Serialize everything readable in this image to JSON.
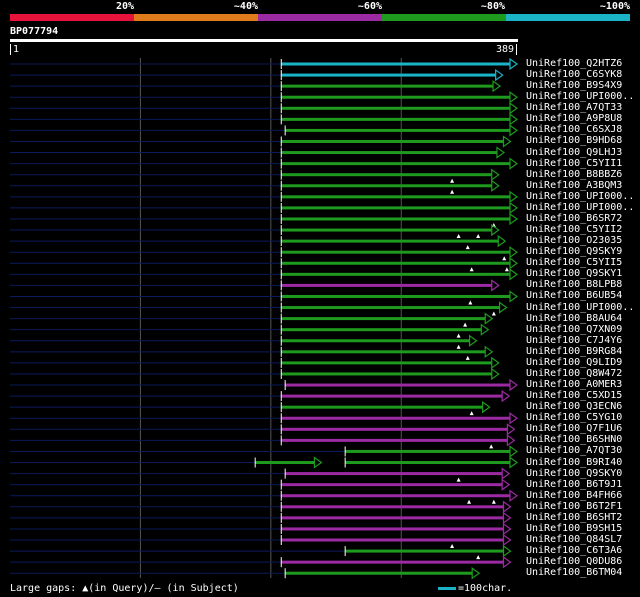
{
  "colors": {
    "red": "#e8133a",
    "orange": "#e07c1c",
    "purple": "#9b2aa3",
    "green": "#1e9a1e",
    "cyan": "#1ab3c8",
    "bg": "#000000"
  },
  "legend": {
    "labels": [
      "20%",
      "~40%",
      "~60%",
      "~80%",
      "~100%"
    ]
  },
  "query": {
    "id": "BP077794",
    "start": "1",
    "end": "389"
  },
  "footer": {
    "gaps_text": "Large gaps: ▲(in Query)/– (in Subject)",
    "scale_text": "=100char."
  },
  "hits": [
    {
      "label": "UniRef100_Q2HTZ6",
      "color": "cyan",
      "s": 209,
      "e": 389,
      "ext": 1,
      "marks": []
    },
    {
      "label": "UniRef100_C6SYK8",
      "color": "cyan",
      "s": 209,
      "e": 378,
      "ext": 1,
      "marks": []
    },
    {
      "label": "UniRef100_B9S4X9",
      "color": "green",
      "s": 209,
      "e": 376,
      "ext": 1,
      "marks": []
    },
    {
      "label": "UniRef100_UPI000..",
      "color": "green",
      "s": 209,
      "e": 389,
      "ext": 1,
      "marks": []
    },
    {
      "label": "UniRef100_A7QT33",
      "color": "green",
      "s": 209,
      "e": 389,
      "ext": 1,
      "marks": []
    },
    {
      "label": "UniRef100_A9P8U8",
      "color": "green",
      "s": 209,
      "e": 389,
      "ext": 1,
      "marks": []
    },
    {
      "label": "UniRef100_C6SXJ8",
      "color": "green",
      "s": 212,
      "e": 389,
      "ext": 1,
      "marks": []
    },
    {
      "label": "UniRef100_B9HD68",
      "color": "green",
      "s": 209,
      "e": 384,
      "ext": 1,
      "marks": []
    },
    {
      "label": "UniRef100_Q9LHJ3",
      "color": "green",
      "s": 209,
      "e": 379,
      "ext": 1,
      "marks": []
    },
    {
      "label": "UniRef100_C5YII1",
      "color": "green",
      "s": 209,
      "e": 389,
      "ext": 1,
      "marks": []
    },
    {
      "label": "UniRef100_B8BBZ6",
      "color": "green",
      "s": 209,
      "e": 375,
      "ext": 1,
      "marks": [
        340
      ]
    },
    {
      "label": "UniRef100_A3BQM3",
      "color": "green",
      "s": 209,
      "e": 375,
      "ext": 1,
      "marks": [
        340
      ]
    },
    {
      "label": "UniRef100_UPI000..",
      "color": "green",
      "s": 209,
      "e": 389,
      "ext": 1,
      "marks": []
    },
    {
      "label": "UniRef100_UPI000..",
      "color": "green",
      "s": 209,
      "e": 389,
      "ext": 1,
      "marks": []
    },
    {
      "label": "UniRef100_B6SR72",
      "color": "green",
      "s": 209,
      "e": 389,
      "ext": 1,
      "marks": [
        372
      ]
    },
    {
      "label": "UniRef100_C5YII2",
      "color": "green",
      "s": 209,
      "e": 375,
      "ext": 1,
      "marks": [
        345,
        360
      ]
    },
    {
      "label": "UniRef100_O23035",
      "color": "green",
      "s": 209,
      "e": 380,
      "ext": 1,
      "marks": [
        352
      ]
    },
    {
      "label": "UniRef100_Q9SKY9",
      "color": "green",
      "s": 209,
      "e": 389,
      "ext": 1,
      "marks": [
        380
      ]
    },
    {
      "label": "UniRef100_C5YII5",
      "color": "green",
      "s": 209,
      "e": 389,
      "ext": 1,
      "marks": [
        355,
        382
      ]
    },
    {
      "label": "UniRef100_Q9SKY1",
      "color": "green",
      "s": 209,
      "e": 389,
      "ext": 1,
      "marks": []
    },
    {
      "label": "UniRef100_B8LPB8",
      "color": "purple",
      "s": 209,
      "e": 375,
      "ext": 1,
      "marks": []
    },
    {
      "label": "UniRef100_B6UB54",
      "color": "green",
      "s": 209,
      "e": 389,
      "ext": 1,
      "marks": [
        354
      ]
    },
    {
      "label": "UniRef100_UPI000..",
      "color": "green",
      "s": 209,
      "e": 381,
      "ext": 1,
      "marks": [
        372
      ]
    },
    {
      "label": "UniRef100_B8AU64",
      "color": "green",
      "s": 209,
      "e": 370,
      "ext": 1,
      "marks": [
        350
      ]
    },
    {
      "label": "UniRef100_Q7XN09",
      "color": "green",
      "s": 209,
      "e": 367,
      "ext": 1,
      "marks": [
        345
      ]
    },
    {
      "label": "UniRef100_C7J4Y6",
      "color": "green",
      "s": 209,
      "e": 358,
      "ext": 1,
      "marks": [
        345
      ]
    },
    {
      "label": "UniRef100_B9RG84",
      "color": "green",
      "s": 209,
      "e": 370,
      "ext": 1,
      "marks": [
        352
      ]
    },
    {
      "label": "UniRef100_Q9LID9",
      "color": "green",
      "s": 209,
      "e": 375,
      "ext": 1,
      "marks": []
    },
    {
      "label": "UniRef100_Q8W472",
      "color": "green",
      "s": 209,
      "e": 375,
      "ext": 1,
      "marks": []
    },
    {
      "label": "UniRef100_A0MER3",
      "color": "purple",
      "s": 212,
      "e": 389,
      "ext": 1,
      "marks": []
    },
    {
      "label": "UniRef100_C5XD15",
      "color": "purple",
      "s": 209,
      "e": 383,
      "ext": 1,
      "marks": []
    },
    {
      "label": "UniRef100_Q3ECN6",
      "color": "green",
      "s": 209,
      "e": 368,
      "ext": 1,
      "marks": [
        355
      ]
    },
    {
      "label": "UniRef100_C5YG10",
      "color": "purple",
      "s": 209,
      "e": 389,
      "ext": 1,
      "marks": []
    },
    {
      "label": "UniRef100_Q7F1U6",
      "color": "purple",
      "s": 209,
      "e": 387,
      "ext": 1,
      "marks": []
    },
    {
      "label": "UniRef100_B6SHN0",
      "color": "purple",
      "s": 209,
      "e": 387,
      "ext": 1,
      "marks": [
        370
      ]
    },
    {
      "label": "UniRef100_A7QT30",
      "color": "green",
      "s": 258,
      "e": 389,
      "ext": 1,
      "marks": []
    },
    {
      "label": "UniRef100_B9RI40",
      "color": "green",
      "s": 189,
      "e": 239,
      "ext": 1,
      "marks": [],
      "s2": 258,
      "e2": 389
    },
    {
      "label": "UniRef100_Q9SKY0",
      "color": "purple",
      "s": 212,
      "e": 383,
      "ext": 1,
      "marks": [
        345
      ]
    },
    {
      "label": "UniRef100_B6T9J1",
      "color": "purple",
      "s": 209,
      "e": 383,
      "ext": 1,
      "marks": []
    },
    {
      "label": "UniRef100_B4FH66",
      "color": "purple",
      "s": 209,
      "e": 389,
      "ext": 1,
      "marks": [
        353,
        372
      ]
    },
    {
      "label": "UniRef100_B6T2F1",
      "color": "purple",
      "s": 209,
      "e": 384,
      "ext": 1,
      "marks": []
    },
    {
      "label": "UniRef100_B6SHT2",
      "color": "purple",
      "s": 209,
      "e": 384,
      "ext": 1,
      "marks": []
    },
    {
      "label": "UniRef100_B9SH15",
      "color": "purple",
      "s": 209,
      "e": 384,
      "ext": 1,
      "marks": []
    },
    {
      "label": "UniRef100_Q84SL7",
      "color": "purple",
      "s": 209,
      "e": 384,
      "ext": 1,
      "marks": [
        340
      ]
    },
    {
      "label": "UniRef100_C6T3A6",
      "color": "green",
      "s": 258,
      "e": 384,
      "ext": 1,
      "marks": [
        360
      ]
    },
    {
      "label": "UniRef100_Q0DU86",
      "color": "purple",
      "s": 209,
      "e": 384,
      "ext": 1,
      "marks": []
    },
    {
      "label": "UniRef100_B6TM04",
      "color": "green",
      "s": 212,
      "e": 360,
      "ext": 1,
      "marks": []
    }
  ]
}
